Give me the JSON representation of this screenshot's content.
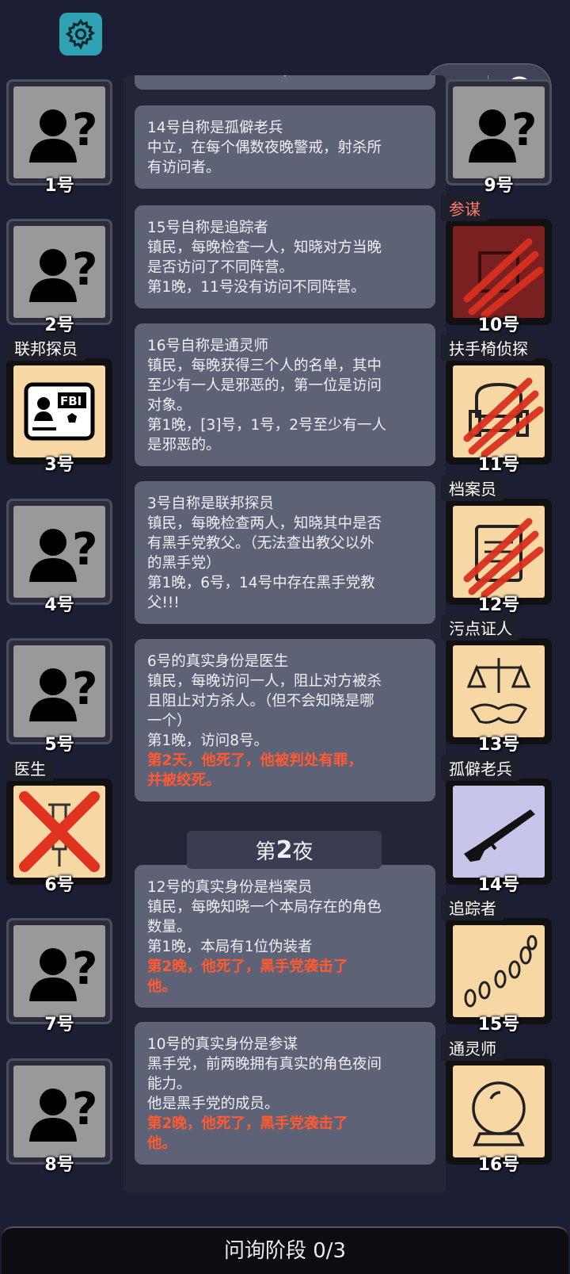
{
  "colors": {
    "background": "#1c1f33",
    "card": "#5e6276",
    "death_text": "#ff5a32",
    "settings": "#2fa3b3",
    "known_tile": "#f7d7a4",
    "evil_tile": "#7a2020"
  },
  "toolbar": {
    "settings_icon": "gear-icon",
    "menu_icon": "more-dots-icon",
    "close_icon": "target-close-icon"
  },
  "log": {
    "top_partial": "·",
    "cards": [
      {
        "lines": [
          "14号自称是孤僻老兵",
          "中立，在每个偶数夜晚警戒，射杀所",
          "有访问者。"
        ],
        "death": []
      },
      {
        "lines": [
          "15号自称是追踪者",
          "镇民，每晚检查一人，知晓对方当晚",
          "是否访问了不同阵营。",
          "第1晚，11号没有访问不同阵营。"
        ],
        "death": []
      },
      {
        "lines": [
          "16号自称是通灵师",
          "镇民，每晚获得三个人的名单，其中",
          "至少有一人是邪恶的，第一位是访问",
          "对象。",
          "第1晚，[3]号，1号，2号至少有一人",
          "是邪恶的。"
        ],
        "death": []
      },
      {
        "lines": [
          "3号自称是联邦探员",
          "镇民，每晚检查两人，知晓其中是否",
          "有黑手党教父。（无法查出教父以外",
          "的黑手党）",
          "第1晚，6号，14号中存在黑手党教",
          "父!!!"
        ],
        "death": []
      },
      {
        "lines": [
          "6号的真实身份是医生",
          "镇民，每晚访问一人，阻止对方被杀",
          "且阻止对方杀人。（但不会知晓是哪",
          "一个）",
          "第1晚，访问8号。"
        ],
        "death": [
          "第2天，他死了，他被判处有罪，",
          "并被绞死。"
        ]
      },
      {
        "lines": [
          "12号的真实身份是档案员",
          "镇民，每晚知晓一个本局存在的角色",
          "数量。",
          "第1晚，本局有1位伪装者"
        ],
        "death": [
          "第2晚，他死了，黑手党袭击了",
          "他。"
        ]
      },
      {
        "lines": [
          "10号的真实身份是参谋",
          "黑手党，前两晚拥有真实的角色夜间",
          "能力。",
          "他是黑手党的成员。"
        ],
        "death": [
          "第2晚，他死了，黑手党袭击了",
          "他。"
        ]
      }
    ],
    "night_banner": {
      "prefix": "第",
      "number": "2",
      "suffix": "夜"
    }
  },
  "players_left": [
    {
      "num": "1号",
      "role": "",
      "icon": "unknown-person-icon"
    },
    {
      "num": "2号",
      "role": "",
      "icon": "unknown-person-icon"
    },
    {
      "num": "3号",
      "role": "联邦探员",
      "icon": "fbi-badge-icon"
    },
    {
      "num": "4号",
      "role": "",
      "icon": "unknown-person-icon"
    },
    {
      "num": "5号",
      "role": "",
      "icon": "unknown-person-icon"
    },
    {
      "num": "6号",
      "role": "医生",
      "icon": "syringe-crossed-icon"
    },
    {
      "num": "7号",
      "role": "",
      "icon": "unknown-person-icon"
    },
    {
      "num": "8号",
      "role": "",
      "icon": "unknown-person-icon"
    }
  ],
  "players_right": [
    {
      "num": "9号",
      "role": "",
      "icon": "unknown-person-icon"
    },
    {
      "num": "10号",
      "role": "参谋",
      "icon": "claw-scratch-icon"
    },
    {
      "num": "11号",
      "role": "扶手椅侦探",
      "icon": "armchair-scratched-icon"
    },
    {
      "num": "12号",
      "role": "档案员",
      "icon": "archive-scratched-icon"
    },
    {
      "num": "13号",
      "role": "污点证人",
      "icon": "scales-handshake-icon"
    },
    {
      "num": "14号",
      "role": "孤僻老兵",
      "icon": "rifle-icon"
    },
    {
      "num": "15号",
      "role": "追踪者",
      "icon": "footprints-icon"
    },
    {
      "num": "16号",
      "role": "通灵师",
      "icon": "crystal-ball-icon"
    }
  ],
  "bottom_bar": {
    "label": "问询阶段 0/3"
  }
}
